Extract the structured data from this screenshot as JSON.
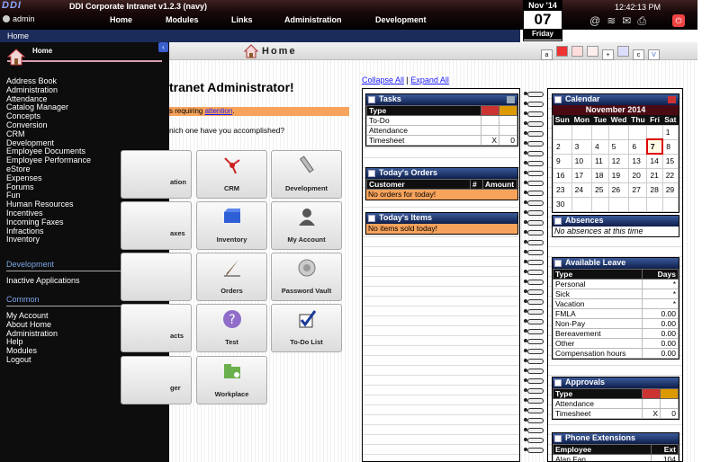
{
  "header": {
    "logo": "DDI",
    "app_title": "DDI Corporate Intranet v1.2.3 (navy)",
    "user": "admin",
    "time": "12:42:13 PM",
    "nav": [
      "Home",
      "Modules",
      "Links",
      "Administration",
      "Development"
    ],
    "date": {
      "month": "Nov '14",
      "day": "07",
      "weekday": "Friday"
    }
  },
  "breadcrumb": "Home",
  "sidebar": {
    "home_label": "Home",
    "items": [
      "Address Book",
      "Administration",
      "Attendance",
      "Catalog Manager",
      "Concepts",
      "Conversion",
      "CRM",
      "Development",
      "Employee Documents",
      "Employee Performance",
      "eStore",
      "Expenses",
      "Forums",
      "Fun",
      "Human Resources",
      "Incentives",
      "Incoming Faxes",
      "Infractions",
      "Inventory"
    ],
    "dev_title": "Development",
    "dev_items": [
      "Inactive Applications"
    ],
    "common_title": "Common",
    "common_items": [
      "My Account",
      "About Home",
      "Administration",
      "Help",
      "Modules",
      "Logout"
    ]
  },
  "page": {
    "title": "Home",
    "welcome": "tranet Administrator!",
    "alert_prefix": "s requiring ",
    "alert_link": "attention",
    "alert_suffix": ".",
    "question": "nich one have you accomplished?",
    "collapse_all": "Collapse All",
    "expand_all": "Expand All"
  },
  "tiles": [
    [
      "ation",
      "CRM",
      "Development"
    ],
    [
      "axes",
      "Inventory",
      "My Account"
    ],
    [
      "",
      "Orders",
      "Password Vault"
    ],
    [
      "acts",
      "Test",
      "To-Do List"
    ],
    [
      "ger",
      "Workplace",
      ""
    ]
  ],
  "tasks": {
    "title": "Tasks",
    "header": "Type",
    "rows": [
      {
        "type": "To-Do",
        "a": "",
        "b": ""
      },
      {
        "type": "Attendance",
        "a": "",
        "b": ""
      },
      {
        "type": "Timesheet",
        "a": "X",
        "b": "0"
      }
    ]
  },
  "orders": {
    "title": "Today's Orders",
    "cols": [
      "Customer",
      "#",
      "Amount"
    ],
    "empty": "No orders for today!"
  },
  "items": {
    "title": "Today's Items",
    "empty": "No items sold today!"
  },
  "calendar": {
    "title": "Calendar",
    "month": "November 2014",
    "days": [
      "Sun",
      "Mon",
      "Tue",
      "Wed",
      "Thu",
      "Fri",
      "Sat"
    ],
    "weeks": [
      [
        "",
        "",
        "",
        "",
        "",
        "",
        "1"
      ],
      [
        "2",
        "3",
        "4",
        "5",
        "6",
        "7",
        "8"
      ],
      [
        "9",
        "10",
        "11",
        "12",
        "13",
        "14",
        "15"
      ],
      [
        "16",
        "17",
        "18",
        "19",
        "20",
        "21",
        "22"
      ],
      [
        "23",
        "24",
        "25",
        "26",
        "27",
        "28",
        "29"
      ],
      [
        "30",
        "",
        "",
        "",
        "",
        "",
        ""
      ]
    ],
    "today": "7"
  },
  "absences": {
    "title": "Absences",
    "empty": "No absences at this time"
  },
  "leave": {
    "title": "Available Leave",
    "cols": [
      "Type",
      "Days"
    ],
    "rows": [
      [
        "Personal",
        "*"
      ],
      [
        "Sick",
        "*"
      ],
      [
        "Vacation",
        "*"
      ],
      [
        "FMLA",
        "0.00"
      ],
      [
        "Non-Pay",
        "0.00"
      ],
      [
        "Bereavement",
        "0.00"
      ],
      [
        "Other",
        "0.00"
      ],
      [
        "Compensation hours",
        "0.00"
      ]
    ]
  },
  "approvals": {
    "title": "Approvals",
    "header": "Type",
    "rows": [
      {
        "type": "Attendance",
        "a": "",
        "b": ""
      },
      {
        "type": "Timesheet",
        "a": "X",
        "b": "0"
      }
    ]
  },
  "extensions": {
    "title": "Phone Extensions",
    "cols": [
      "Employee",
      "Ext"
    ],
    "rows": [
      [
        "Alan Fan",
        "104"
      ]
    ]
  }
}
